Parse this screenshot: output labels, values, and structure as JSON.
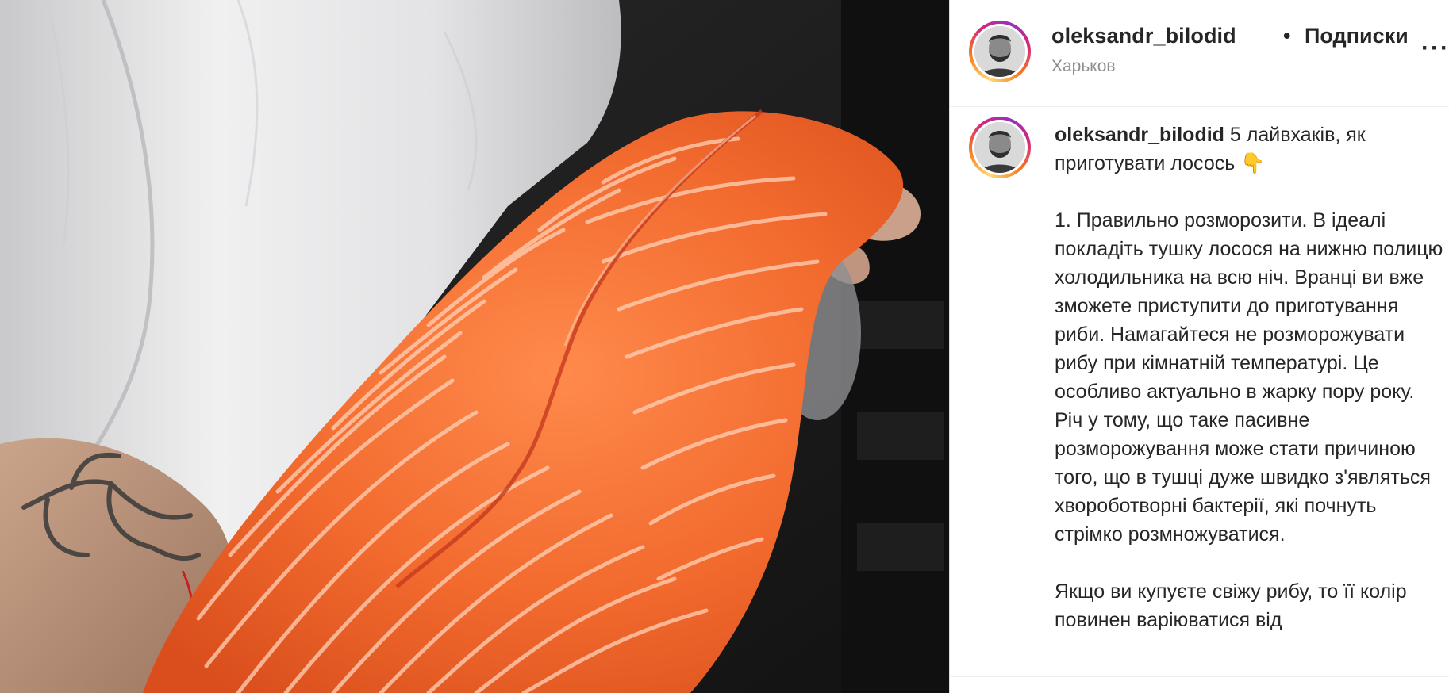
{
  "post": {
    "username": "oleksandr_bilodid",
    "separator": "•",
    "follow_label": "Подписки",
    "location": "Харьков",
    "more_label": "···"
  },
  "caption": {
    "username": "oleksandr_bilodid",
    "intro": "5 лайвхаків, як приготувати лосось 👇",
    "paragraph1": "1. Правильно розморозити. В ідеалі покладіть тушку лосося на нижню полицю холодильника на всю ніч. Вранці ви вже зможете приступити до приготування риби. Намагайтеся не розморожувати рибу при кімнатній температурі. Це особливо актуально в жарку пору року. Річ у тому, що таке пасивне розморожування може стати причиною того, що в тушці дуже швидко з'являться хвороботворні бактерії, які почнуть стрімко розмножуватися.",
    "paragraph2": "Якщо ви купуєте свіжу рибу, то її колір повинен варіюватися від"
  },
  "colors": {
    "salmon": "#f26a2e",
    "salmon_light": "#ff9a62",
    "fat_line": "#ffd2b8",
    "jacket": "#e9e9ea",
    "background_dark": "#1b1b1b",
    "text": "#262626",
    "muted": "#8e8e8e"
  },
  "icons": {
    "avatar": "avatar-icon",
    "more": "more-options-icon"
  }
}
